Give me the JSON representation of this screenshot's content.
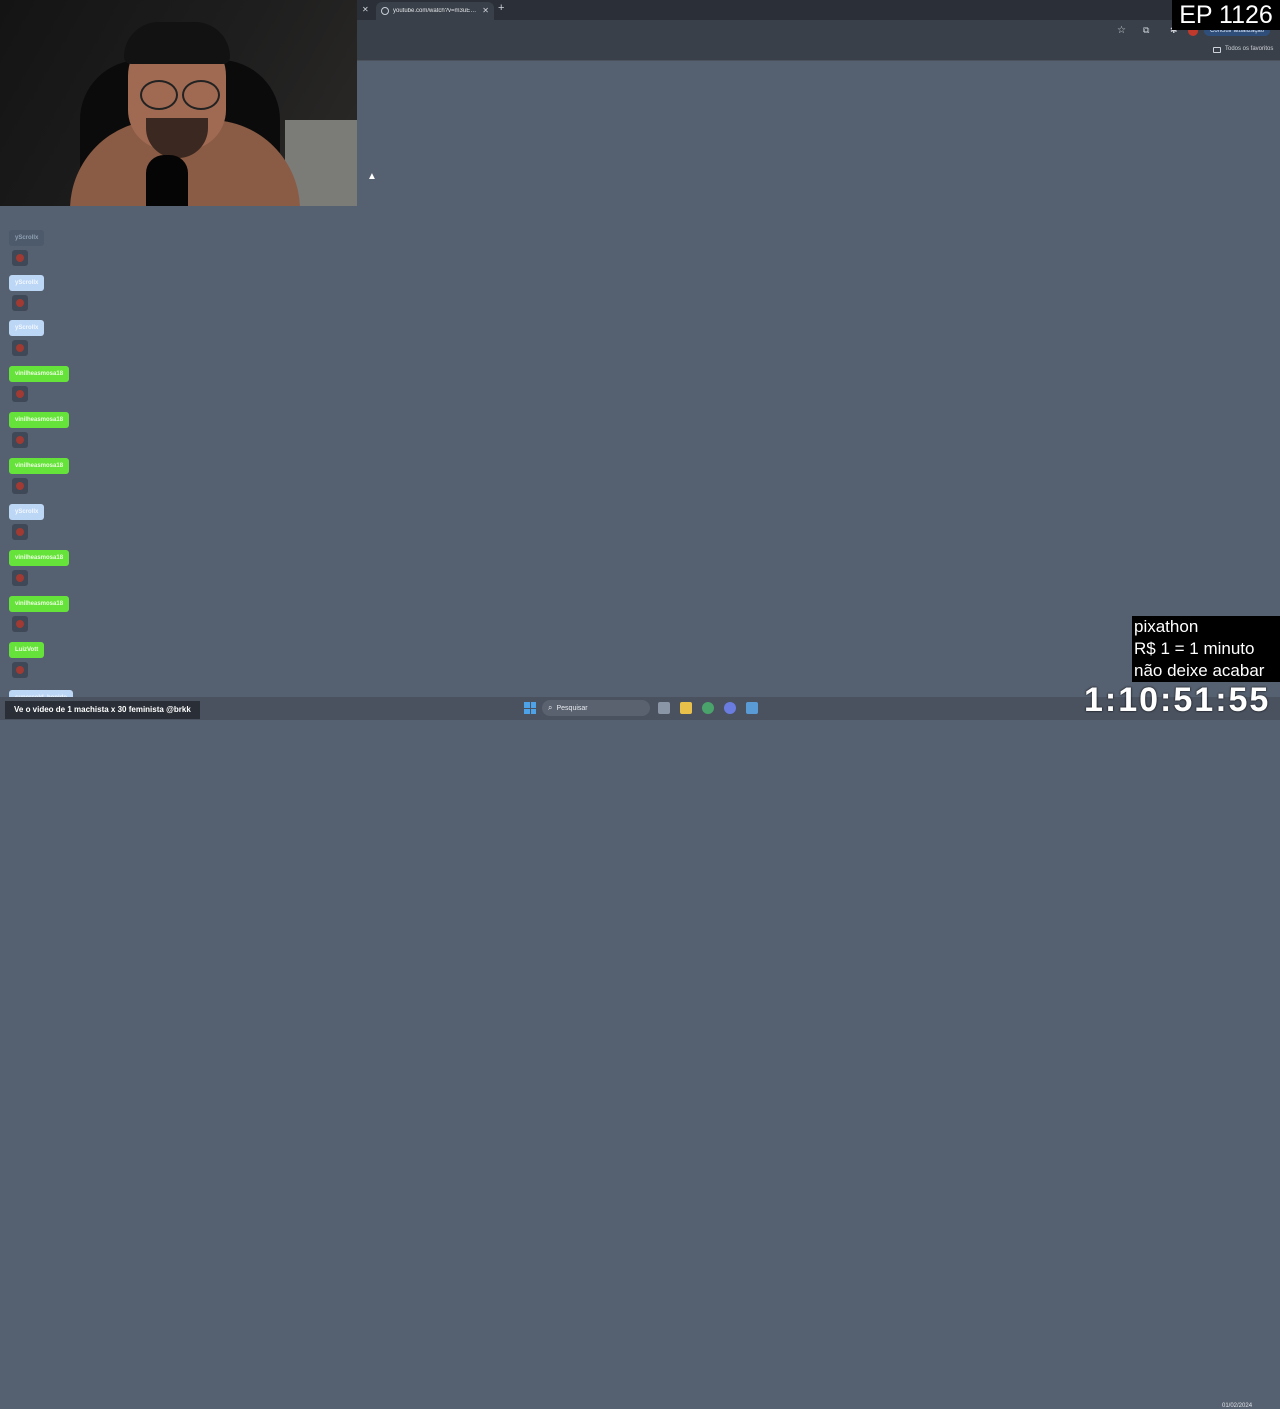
{
  "browser": {
    "tab_title": "youtube.com/watch?v=m3uE…",
    "update_button": "Concluir atualização",
    "bookmarks_label": "Todos os favoritos"
  },
  "chat": {
    "messages": [
      {
        "name": "yScrollx",
        "color": "faded"
      },
      {
        "name": "yScrollx",
        "color": "blue"
      },
      {
        "name": "yScrollx",
        "color": "blue"
      },
      {
        "name": "vinilheasmosa18",
        "color": "green"
      },
      {
        "name": "vinilheasmosa18",
        "color": "green"
      },
      {
        "name": "vinilheasmosa18",
        "color": "green"
      },
      {
        "name": "yScrollx",
        "color": "blue"
      },
      {
        "name": "vinilheasmosa18",
        "color": "green"
      },
      {
        "name": "vinilheasmosa18",
        "color": "green"
      },
      {
        "name": "LuizVott",
        "color": "green"
      },
      {
        "name": "supercold_bonido",
        "color": "blue"
      }
    ],
    "caption": "Ve o video de 1 machista x 30 feminista @brkk"
  },
  "overlay": {
    "episode": "EP 1126",
    "pix_line1": "pixathon",
    "pix_line2": "R$ 1 = 1 minuto",
    "pix_line3": "não deixe acabar",
    "timer": "1:10:51:55"
  },
  "taskbar": {
    "search_placeholder": "Pesquisar",
    "clock": "01/02/2024"
  },
  "colors": {
    "page_background": "#556070",
    "chat_green": "#66e33a",
    "chat_blue": "#bcd6f5"
  }
}
